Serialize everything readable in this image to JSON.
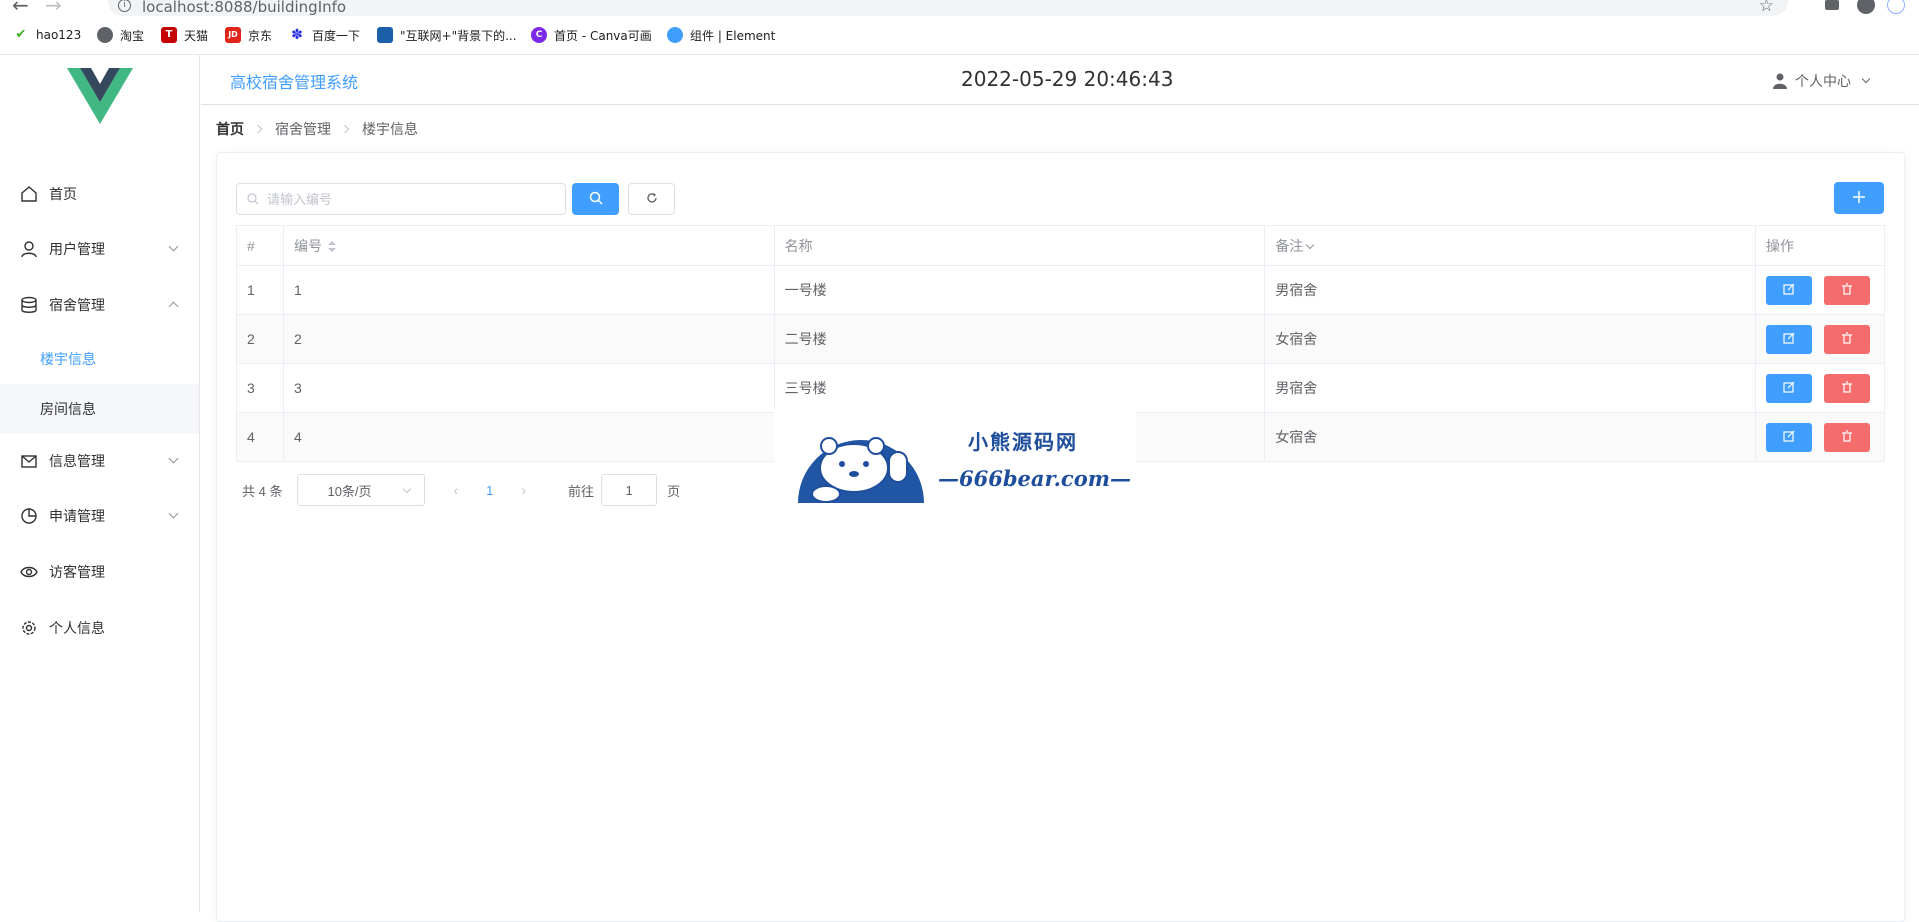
{
  "browser": {
    "url": "localhost:8088/buildingInfo",
    "bookmarks": [
      {
        "label": "hao123",
        "color": "#3fae29"
      },
      {
        "label": "淘宝",
        "color": "#5f6368"
      },
      {
        "label": "天猫",
        "color": "#c40000"
      },
      {
        "label": "京东",
        "color": "#e1251b"
      },
      {
        "label": "百度一下",
        "color": "#2932e1"
      },
      {
        "label": "\"互联网+\"背景下的...",
        "color": "#1b5fa8"
      },
      {
        "label": "首页 - Canva可画",
        "color": "#7d2ae8"
      },
      {
        "label": "组件 | Element",
        "color": "#409eff"
      }
    ]
  },
  "header": {
    "title": "高校宿舍管理系统",
    "clock": "2022-05-29 20:46:43",
    "user_menu": "个人中心"
  },
  "sidebar": {
    "items": [
      {
        "label": "首页",
        "icon": "home-icon"
      },
      {
        "label": "用户管理",
        "icon": "user-icon"
      },
      {
        "label": "宿舍管理",
        "icon": "database-icon"
      },
      {
        "label": "信息管理",
        "icon": "message-icon"
      },
      {
        "label": "申请管理",
        "icon": "pie-chart-icon"
      },
      {
        "label": "访客管理",
        "icon": "eye-icon"
      },
      {
        "label": "个人信息",
        "icon": "gear-icon"
      }
    ],
    "subitems": [
      {
        "label": "楼宇信息"
      },
      {
        "label": "房间信息"
      }
    ]
  },
  "breadcrumb": [
    "首页",
    "宿舍管理",
    "楼宇信息"
  ],
  "search": {
    "placeholder": "请输入编号"
  },
  "table": {
    "headers": {
      "index": "#",
      "code": "编号",
      "name": "名称",
      "remark": "备注",
      "ops": "操作"
    },
    "rows": [
      {
        "index": "1",
        "code": "1",
        "name": "一号楼",
        "remark": "男宿舍"
      },
      {
        "index": "2",
        "code": "2",
        "name": "二号楼",
        "remark": "女宿舍"
      },
      {
        "index": "3",
        "code": "3",
        "name": "三号楼",
        "remark": "男宿舍"
      },
      {
        "index": "4",
        "code": "4",
        "name": "",
        "remark": "女宿舍"
      }
    ]
  },
  "pagination": {
    "total": "共 4 条",
    "page_size": "10条/页",
    "current_page": "1",
    "goto_label": "前往",
    "goto_value": "1",
    "goto_unit": "页"
  },
  "watermark": {
    "line1": "小熊源码网",
    "line2": "—666bear.com—"
  },
  "colors": {
    "primary": "#409eff",
    "danger": "#f56c6c"
  }
}
